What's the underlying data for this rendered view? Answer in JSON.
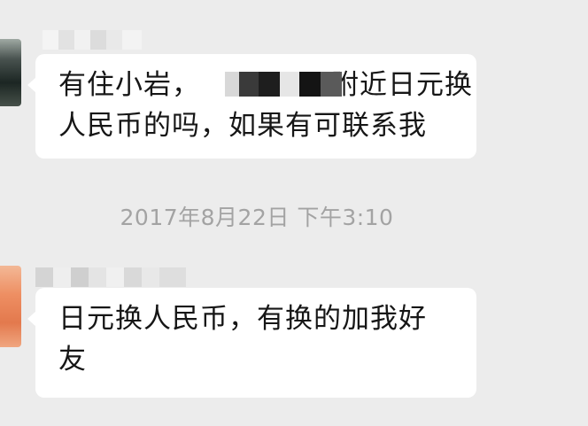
{
  "messages": [
    {
      "sender_avatar": "blurred-avatar",
      "sender_name": "",
      "line_1": "有住小岩，",
      "line_1_tail": "附近日元换",
      "line_2": "人民币的吗，如果有可联系我"
    },
    {
      "sender_avatar": "blurred-avatar",
      "sender_name": "",
      "line_1": "日元换人民币，有换的加我好",
      "line_2": "友"
    }
  ],
  "timestamp": "2017年8月22日 下午3:10",
  "colors": {
    "background": "#ececec",
    "bubble": "#ffffff",
    "message_text": "#161616",
    "timestamp_text": "#a3a3a3"
  }
}
